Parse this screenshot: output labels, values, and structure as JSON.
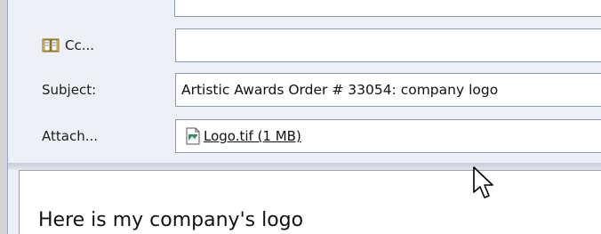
{
  "header": {
    "cc": {
      "label": "Cc...",
      "value": ""
    },
    "subject": {
      "label": "Subject:",
      "value": "Artistic Awards Order # 33054: company logo"
    },
    "attach": {
      "label": "Attach...",
      "file": "Logo.tif (1 MB)"
    }
  },
  "message": {
    "body": "Here is my company's logo"
  },
  "icons": {
    "address_book": "address-book-icon",
    "attachment_doc": "document-icon",
    "cursor": "mouse-pointer-icon"
  }
}
